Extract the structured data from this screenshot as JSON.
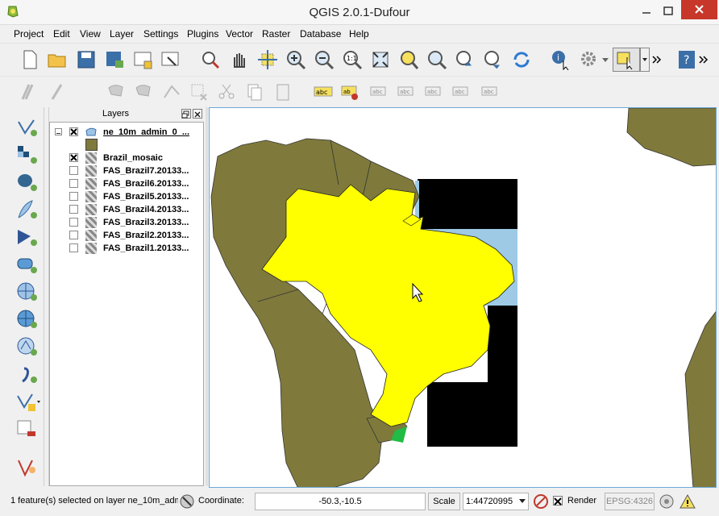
{
  "window": {
    "title": "QGIS 2.0.1-Dufour"
  },
  "menu": [
    "Project",
    "Edit",
    "View",
    "Layer",
    "Settings",
    "Plugins",
    "Vector",
    "Raster",
    "Database",
    "Help"
  ],
  "panel": {
    "title": "Layers"
  },
  "layers": [
    {
      "name": "ne_10m_admin_0_...",
      "checked": true,
      "kind": "vector"
    },
    {
      "name": "Brazil_mosaic",
      "checked": true,
      "kind": "raster"
    },
    {
      "name": "FAS_Brazil7.20133...",
      "checked": false,
      "kind": "raster"
    },
    {
      "name": "FAS_Brazil6.20133...",
      "checked": false,
      "kind": "raster"
    },
    {
      "name": "FAS_Brazil5.20133...",
      "checked": false,
      "kind": "raster"
    },
    {
      "name": "FAS_Brazil4.20133...",
      "checked": false,
      "kind": "raster"
    },
    {
      "name": "FAS_Brazil3.20133...",
      "checked": false,
      "kind": "raster"
    },
    {
      "name": "FAS_Brazil2.20133...",
      "checked": false,
      "kind": "raster"
    },
    {
      "name": "FAS_Brazil1.20133...",
      "checked": false,
      "kind": "raster"
    }
  ],
  "status": {
    "message": "1 feature(s) selected on layer ne_10m_adm",
    "coord_label": "Coordinate:",
    "coord_value": "-50.3,-10.5",
    "scale_label": "Scale",
    "scale_value": "1:44720995",
    "render_label": "Render",
    "crs": "EPSG:4326"
  },
  "colors": {
    "land": "#7f7a3c",
    "selected": "#ffff00",
    "water": "#9ecae6",
    "nodata": "#000000"
  }
}
